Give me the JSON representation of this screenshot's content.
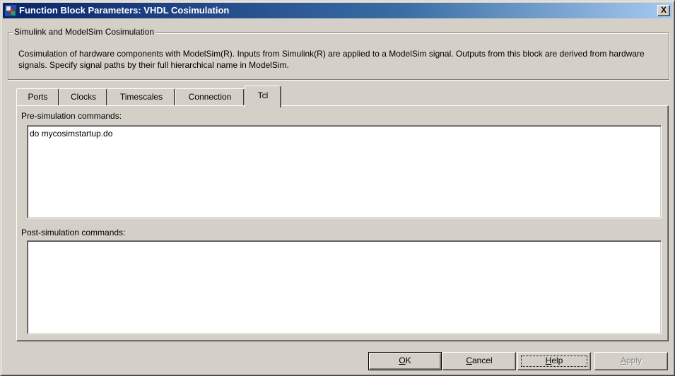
{
  "window": {
    "title": "Function Block Parameters: VHDL Cosimulation",
    "close_label": "X"
  },
  "group": {
    "legend": "Simulink and ModelSim Cosimulation",
    "description": "Cosimulation of hardware components with ModelSim(R). Inputs from Simulink(R) are applied to a ModelSim signal. Outputs from this block are derived from hardware signals. Specify signal paths by their full hierarchical name in ModelSim."
  },
  "tabs": [
    {
      "label": "Ports"
    },
    {
      "label": "Clocks"
    },
    {
      "label": "Timescales"
    },
    {
      "label": "Connection"
    },
    {
      "label": "Tcl",
      "active": true
    }
  ],
  "tcl": {
    "pre_label": "Pre-simulation commands:",
    "pre_value": "do mycosimstartup.do",
    "post_label": "Post-simulation commands:",
    "post_value": ""
  },
  "buttons": {
    "ok": {
      "mnemonic": "O",
      "rest": "K"
    },
    "cancel": {
      "mnemonic": "C",
      "rest": "ancel"
    },
    "help": {
      "mnemonic": "H",
      "rest": "elp"
    },
    "apply": {
      "mnemonic": "A",
      "rest": "pply"
    }
  },
  "colors": {
    "titlebar_start": "#0a246a",
    "titlebar_end": "#a6caf0",
    "face": "#d4d0c8"
  }
}
